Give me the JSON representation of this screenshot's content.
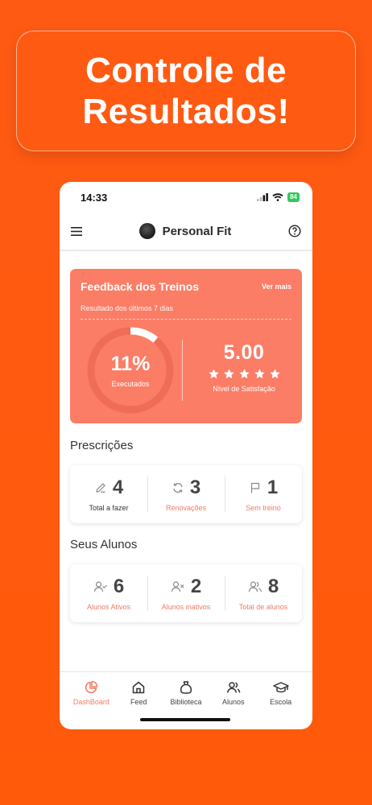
{
  "headline": {
    "line1": "Controle de",
    "line2": "Resultados!"
  },
  "status_bar": {
    "time": "14:33",
    "battery": "84"
  },
  "app_bar": {
    "title": "Personal Fit"
  },
  "feedback": {
    "title": "Feedback dos Treinos",
    "more_label": "Ver mais",
    "subtitle": "Resultado dos últimos 7 dias",
    "executed_percent": "11%",
    "executed_fraction": 0.11,
    "executed_label": "Executados",
    "satisfaction_value": "5.00",
    "satisfaction_stars": 5,
    "satisfaction_label": "Nível de Satisfação"
  },
  "prescricoes": {
    "title": "Prescrições",
    "stats": [
      {
        "icon": "pencil-icon",
        "value": "4",
        "label": "Total a fazer"
      },
      {
        "icon": "refresh-icon",
        "value": "3",
        "label": "Renovações"
      },
      {
        "icon": "flag-icon",
        "value": "1",
        "label": "Sem treino"
      }
    ]
  },
  "alunos": {
    "title": "Seus Alunos",
    "stats": [
      {
        "icon": "user-check-icon",
        "value": "6",
        "label": "Alunos Ativos"
      },
      {
        "icon": "user-x-icon",
        "value": "2",
        "label": "Alunos inativos"
      },
      {
        "icon": "users-icon",
        "value": "8",
        "label": "Total de alunos"
      }
    ]
  },
  "tabs": [
    {
      "icon": "dashboard-icon",
      "label": "DashBoard",
      "active": true
    },
    {
      "icon": "home-icon",
      "label": "Feed",
      "active": false
    },
    {
      "icon": "bag-icon",
      "label": "Biblioteca",
      "active": false
    },
    {
      "icon": "users-icon",
      "label": "Alunos",
      "active": false
    },
    {
      "icon": "graduation-cap-icon",
      "label": "Escola",
      "active": false
    }
  ],
  "colors": {
    "background": "#ff5a0a",
    "card": "#fb7d66",
    "accent_text": "#f07a63"
  }
}
